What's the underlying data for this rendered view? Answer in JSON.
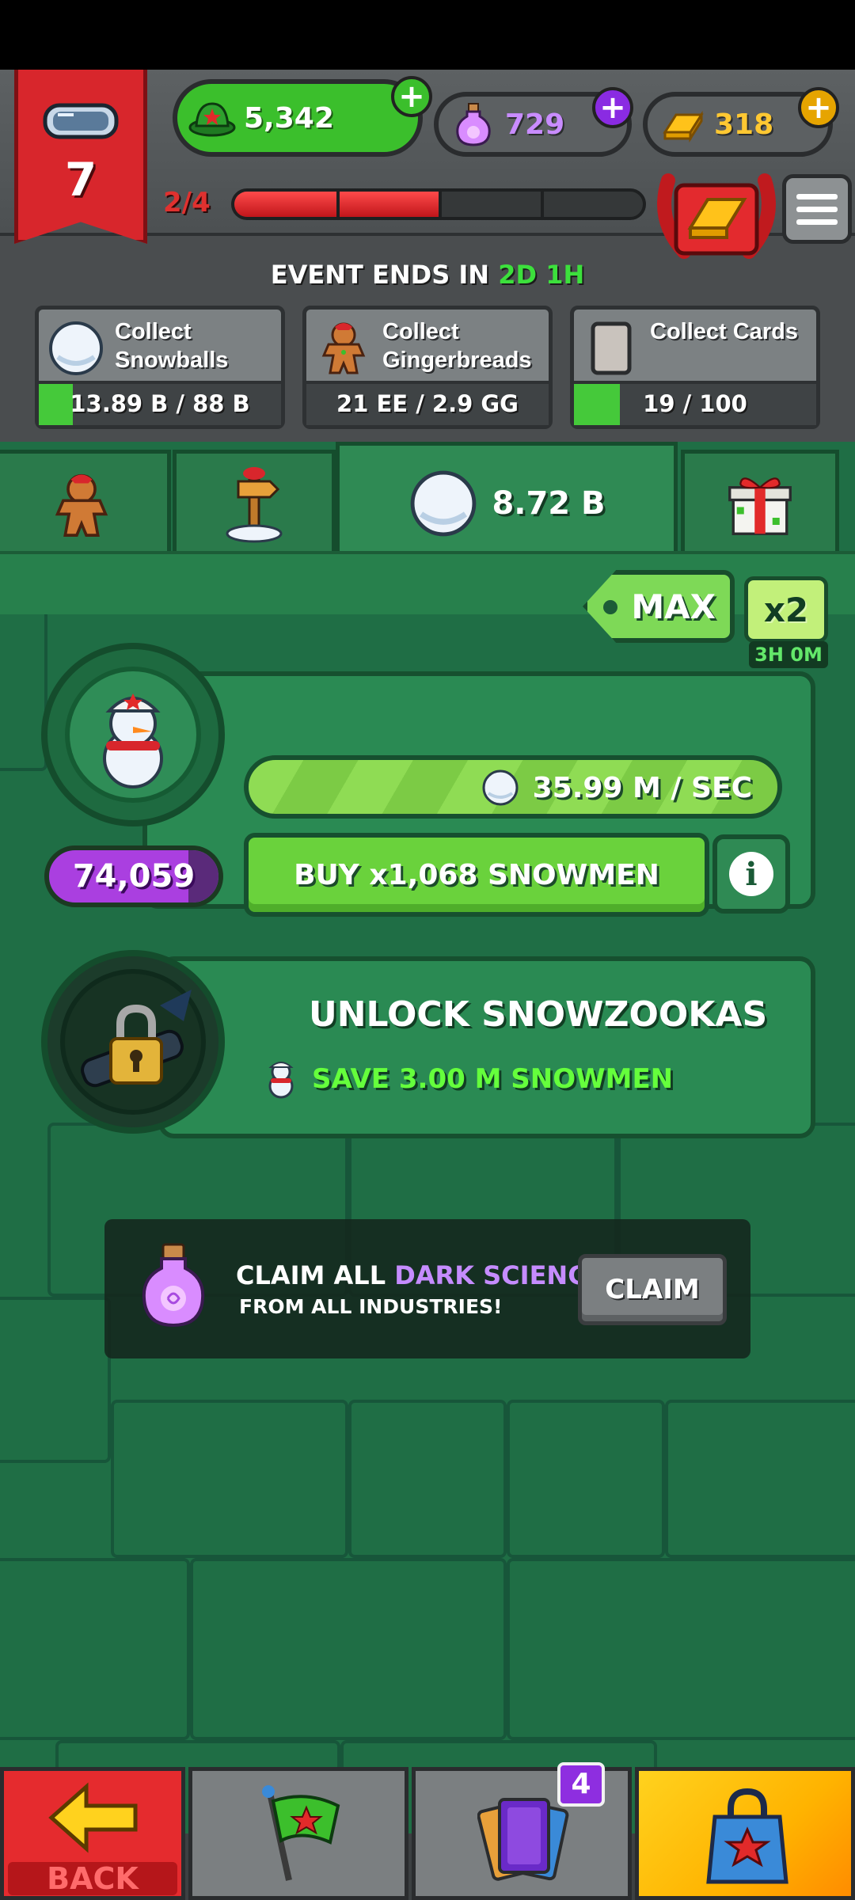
{
  "rank": {
    "level": "7",
    "icon": "goggles-icon"
  },
  "currencies": {
    "hats": {
      "value": "5,342",
      "icon": "green-hat-icon",
      "color": "#3bbf2c"
    },
    "dark_science": {
      "value": "729",
      "icon": "potion-icon",
      "color": "#c98cff"
    },
    "gold": {
      "value": "318",
      "icon": "gold-bar-icon",
      "color": "#ffc832"
    }
  },
  "progress": {
    "label": "2/4",
    "fraction": 0.5
  },
  "event": {
    "prefix": "EVENT ENDS IN",
    "time": "2D 1H"
  },
  "quests": [
    {
      "title_line1": "Collect",
      "title_line2": "Snowballs",
      "value": "13.89 B / 88 B",
      "fraction": 0.14,
      "icon": "snowball-icon"
    },
    {
      "title_line1": "Collect",
      "title_line2": "Gingerbreads",
      "value": "21 EE / 2.9 GG",
      "fraction": 0.0,
      "icon": "gingerbread-icon"
    },
    {
      "title_line1": "Collect Cards",
      "title_line2": "",
      "value": "19 / 100",
      "fraction": 0.19,
      "icon": "card-icon"
    }
  ],
  "tabs": {
    "snowballs_value": "8.72 B"
  },
  "multiplier": {
    "max_label": "MAX",
    "boost_label": "x2",
    "boost_time": "3H 0M"
  },
  "unit": {
    "count": "74,059",
    "rate": "35.99 M / SEC",
    "buy_label": "BUY x1,068 SNOWMEN",
    "info_label": "i"
  },
  "unlock": {
    "title": "UNLOCK SNOWZOOKAS",
    "requirement": "SAVE 3.00 M SNOWMEN"
  },
  "claim": {
    "line1_prefix": "CLAIM ALL",
    "line1_highlight": "DARK SCIENCE",
    "line2": "FROM ALL INDUSTRIES!",
    "button": "CLAIM"
  },
  "bottom_nav": {
    "back_label": "BACK",
    "cards_badge": "4"
  }
}
